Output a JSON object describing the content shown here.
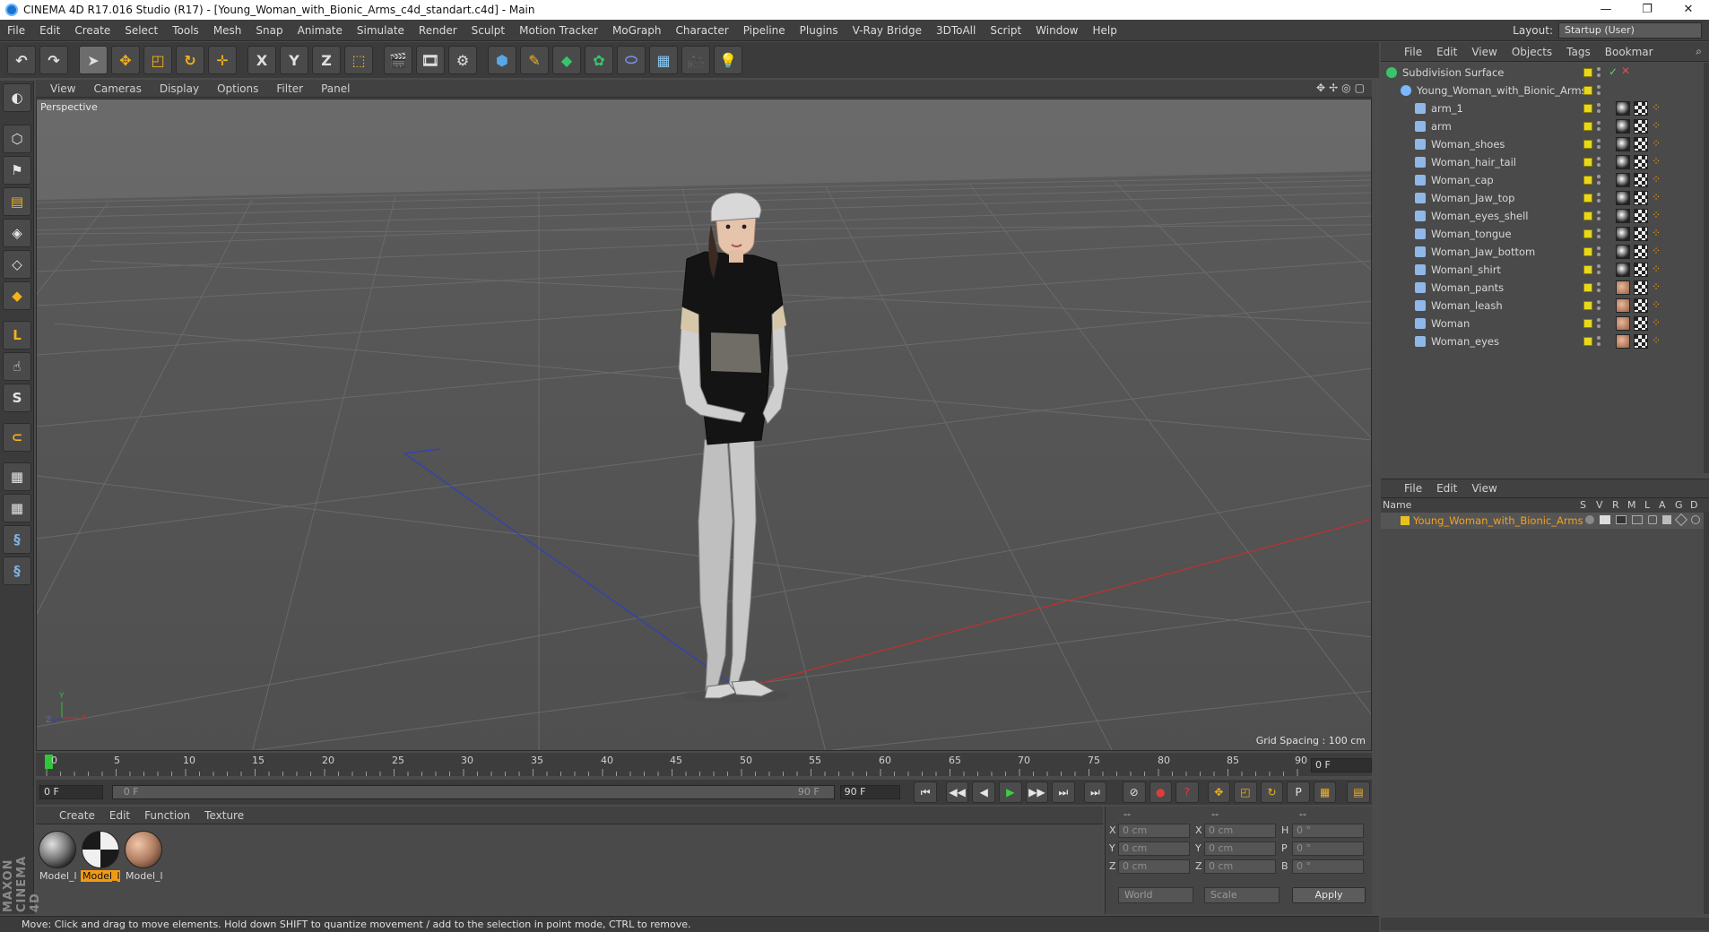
{
  "window": {
    "title": "CINEMA 4D R17.016 Studio (R17) - [Young_Woman_with_Bionic_Arms_c4d_standart.c4d] - Main",
    "controls": [
      "—",
      "❐",
      "✕"
    ]
  },
  "menubar": {
    "items": [
      "File",
      "Edit",
      "Create",
      "Select",
      "Tools",
      "Mesh",
      "Snap",
      "Animate",
      "Simulate",
      "Render",
      "Sculpt",
      "Motion Tracker",
      "MoGraph",
      "Character",
      "Pipeline",
      "Plugins",
      "V-Ray Bridge",
      "3DToAll",
      "Script",
      "Window",
      "Help"
    ],
    "layout_label": "Layout:",
    "layout_value": "Startup (User)"
  },
  "toolbar": {
    "buttons": [
      {
        "name": "undo",
        "glyph": "↶"
      },
      {
        "name": "redo",
        "glyph": "↷"
      },
      {
        "name": "live-selection",
        "glyph": "➤"
      },
      {
        "name": "move",
        "glyph": "✥"
      },
      {
        "name": "scale",
        "glyph": "◰"
      },
      {
        "name": "rotate",
        "glyph": "↻"
      },
      {
        "name": "last-tool",
        "glyph": "✛"
      },
      {
        "name": "x-axis",
        "glyph": "X"
      },
      {
        "name": "y-axis",
        "glyph": "Y"
      },
      {
        "name": "z-axis",
        "glyph": "Z"
      },
      {
        "name": "coordinate-system",
        "glyph": "⬚"
      },
      {
        "name": "render-view",
        "glyph": "🎬"
      },
      {
        "name": "render-picture-viewer",
        "glyph": "🎞"
      },
      {
        "name": "edit-render-settings",
        "glyph": "⚙"
      },
      {
        "name": "cube",
        "glyph": "⬢"
      },
      {
        "name": "spline-pen",
        "glyph": "✎"
      },
      {
        "name": "subdivision",
        "glyph": "◆"
      },
      {
        "name": "cloner",
        "glyph": "✿"
      },
      {
        "name": "deformer",
        "glyph": "⬭"
      },
      {
        "name": "floor",
        "glyph": "▦"
      },
      {
        "name": "camera",
        "glyph": "🎥"
      },
      {
        "name": "light",
        "glyph": "💡"
      }
    ]
  },
  "leftbar": {
    "buttons": [
      "make-editable",
      "model-mode",
      "texture-mode",
      "workplane-mode",
      "points-mode",
      "edges-mode",
      "polygons-mode",
      "axis-mode",
      "tweak-mode",
      "solo-mode",
      "snap-toggle",
      "workplane-lock",
      "workplane-align",
      "python-1",
      "python-2"
    ],
    "glyphs": [
      "◐",
      "⬡",
      "⚑",
      "▤",
      "◈",
      "◇",
      "◆",
      "L",
      "☝",
      "S",
      "⊂",
      "▦",
      "▦",
      "§",
      "§"
    ]
  },
  "viewport": {
    "menu": [
      "View",
      "Cameras",
      "Display",
      "Options",
      "Filter",
      "Panel"
    ],
    "camera_label": "Perspective",
    "grid_spacing": "Grid Spacing : 100 cm",
    "nav_icons": [
      "✥",
      "✢",
      "◎",
      "▢"
    ],
    "axis_labels": {
      "y": "Y",
      "z": "Z",
      "x": "X"
    }
  },
  "timeline": {
    "ticks": [
      "0",
      "5",
      "10",
      "15",
      "20",
      "25",
      "30",
      "35",
      "40",
      "45",
      "50",
      "55",
      "60",
      "65",
      "70",
      "75",
      "80",
      "85",
      "90"
    ],
    "end_field": "0 F",
    "current_frame": "0 F",
    "range_start": "0 F",
    "range_end": "90 F",
    "max_frame": "90 F"
  },
  "transport": {
    "buttons": [
      "⏮",
      "◀◀",
      "◀",
      "▶",
      "▶▶",
      "⏭",
      "⏭"
    ],
    "right_buttons": [
      "⊘",
      "●",
      "?",
      "✥",
      "◰",
      "↻",
      "P",
      "▦",
      "▤"
    ]
  },
  "materials": {
    "menu": [
      "Create",
      "Edit",
      "Function",
      "Texture"
    ],
    "items": [
      {
        "name": "Model_l",
        "active": false,
        "color": "#7a7a7a"
      },
      {
        "name": "Model_l",
        "active": true,
        "color": "#cfcfcf"
      },
      {
        "name": "Model_l",
        "active": false,
        "color": "#b07e62"
      }
    ]
  },
  "coordinates": {
    "headers": [
      "--",
      "--",
      "--"
    ],
    "rows": [
      {
        "a": "X",
        "av": "0 cm",
        "b": "X",
        "bv": "0 cm",
        "c": "H",
        "cv": "0 °"
      },
      {
        "a": "Y",
        "av": "0 cm",
        "b": "Y",
        "bv": "0 cm",
        "c": "P",
        "cv": "0 °"
      },
      {
        "a": "Z",
        "av": "0 cm",
        "b": "Z",
        "bv": "0 cm",
        "c": "B",
        "cv": "0 °"
      }
    ],
    "world": "World",
    "scale": "Scale",
    "apply": "Apply"
  },
  "status": {
    "text": "Move: Click and drag to move elements. Hold down SHIFT to quantize movement / add to the selection in point mode, CTRL to remove.",
    "logo": "MAXON CINEMA 4D"
  },
  "objects": {
    "menu": [
      "File",
      "Edit",
      "View",
      "Objects",
      "Tags",
      "Bookmar"
    ],
    "root": "Subdivision Surface",
    "group": "Young_Woman_with_Bionic_Arms",
    "children": [
      "arm_1",
      "arm",
      "Woman_shoes",
      "Woman_hair_tail",
      "Woman_cap",
      "Woman_Jaw_top",
      "Woman_eyes_shell",
      "Woman_tongue",
      "Woman_Jaw_bottom",
      "Womanl_shirt",
      "Woman_pants",
      "Woman_leash",
      "Woman",
      "Woman_eyes"
    ]
  },
  "layers": {
    "menu": [
      "File",
      "Edit",
      "View"
    ],
    "columns": [
      "Name",
      "S",
      "V",
      "R",
      "M",
      "L",
      "A",
      "G",
      "D"
    ],
    "row": "Young_Woman_with_Bionic_Arms"
  },
  "colors": {
    "accent": "#f19a14",
    "layer_text": "#f2a21e",
    "playhead": "#31c73a",
    "viewport": "#5c5c5c",
    "axis_x": "#c03030",
    "axis_y": "#2fbf3a",
    "axis_z": "#2f3fbf"
  }
}
